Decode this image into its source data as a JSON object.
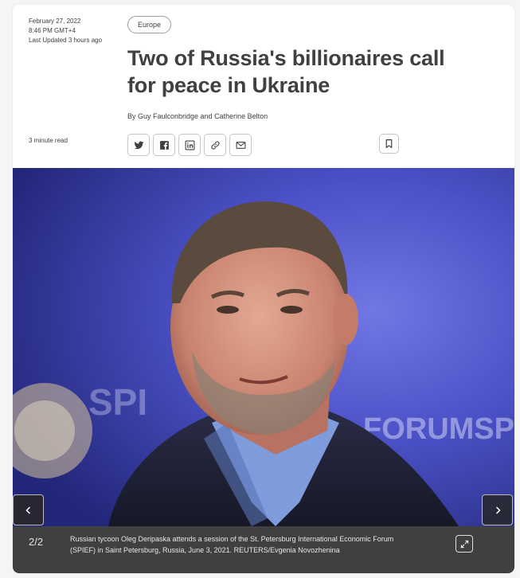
{
  "article": {
    "date": "February 27, 2022",
    "time": "8:46 PM GMT+4",
    "updated": "Last Updated 3 hours ago",
    "read_time": "3 minute read",
    "tag": "Europe",
    "headline": "Two of Russia's billionaires call for peace in Ukraine",
    "byline": "By Guy Faulconbridge and Catherine Belton"
  },
  "share_icons": [
    "twitter-icon",
    "facebook-icon",
    "linkedin-icon",
    "link-icon",
    "email-icon"
  ],
  "gallery": {
    "counter": "2/2",
    "caption": "Russian tycoon Oleg Deripaska attends a session of the St. Petersburg International Economic Forum (SPIEF) in Saint Petersburg, Russia, June 3, 2021. REUTERS/Evgenia Novozhenina",
    "background_text": "FORUMSPB.C"
  },
  "colors": {
    "text": "#404040",
    "caption_bar": "#404040",
    "photo_bg": "#4d52c8"
  }
}
